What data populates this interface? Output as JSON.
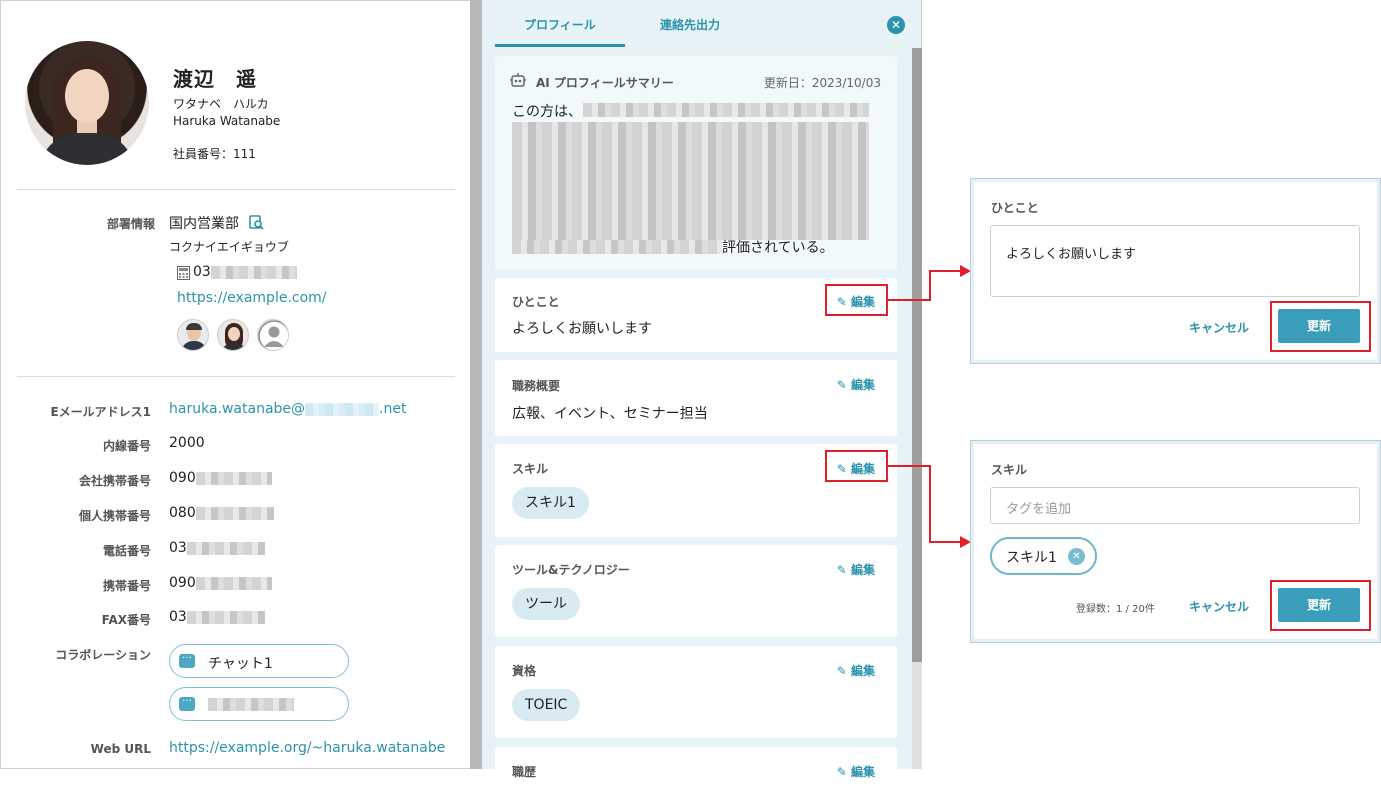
{
  "profile": {
    "name": "渡辺　遥",
    "kana": "ワタナベ　ハルカ",
    "roman": "Haruka Watanabe",
    "employee_no": "社員番号：111"
  },
  "dept": {
    "label": "部署情報",
    "name": "国内営業部",
    "kana": "コクナイエイギョウブ",
    "phone_prefix": "03",
    "url": "https://example.com/"
  },
  "contact": [
    {
      "label": "Eメールアドレス1",
      "value": "haruka.watanabe@",
      "suffix": ".net"
    },
    {
      "label": "内線番号",
      "value": "2000"
    },
    {
      "label": "会社携帯番号",
      "value": "090"
    },
    {
      "label": "個人携帯番号",
      "value": "080"
    },
    {
      "label": "電話番号",
      "value": "03"
    },
    {
      "label": "携帯番号",
      "value": "090"
    },
    {
      "label": "FAX番号",
      "value": "03"
    }
  ],
  "collab": {
    "label": "コラボレーション",
    "chat1": "チャット1"
  },
  "weburl": {
    "label": "Web URL",
    "value": "https://example.org/~haruka.watanabe"
  },
  "tabs": {
    "profile": "プロフィール",
    "export": "連絡先出力"
  },
  "ai": {
    "title": "AI プロフィールサマリー",
    "updated": "更新日：2023/10/03",
    "intro": "この方は、",
    "ending": "評価されている。"
  },
  "cards": {
    "edit": "編集",
    "hitokoto": {
      "title": "ひとこと",
      "body": "よろしくお願いします"
    },
    "duties": {
      "title": "職務概要",
      "body": "広報、イベント、セミナー担当"
    },
    "skills": {
      "title": "スキル",
      "chip": "スキル1"
    },
    "tools": {
      "title": "ツール&テクノロジー",
      "chip": "ツール"
    },
    "certs": {
      "title": "資格",
      "chip": "TOEIC"
    },
    "more": {
      "title": "職歴"
    }
  },
  "popup_hitokoto": {
    "title": "ひとこと",
    "value": "よろしくお願いします",
    "cancel": "キャンセル",
    "update": "更新"
  },
  "popup_skill": {
    "title": "スキル",
    "placeholder": "タグを追加",
    "chip": "スキル1",
    "count": "登録数：1 / 20件",
    "cancel": "キャンセル",
    "update": "更新"
  },
  "colors": {
    "accent": "#2b93ad",
    "highlight": "#e01f2d",
    "panel": "#e7f3f7"
  }
}
